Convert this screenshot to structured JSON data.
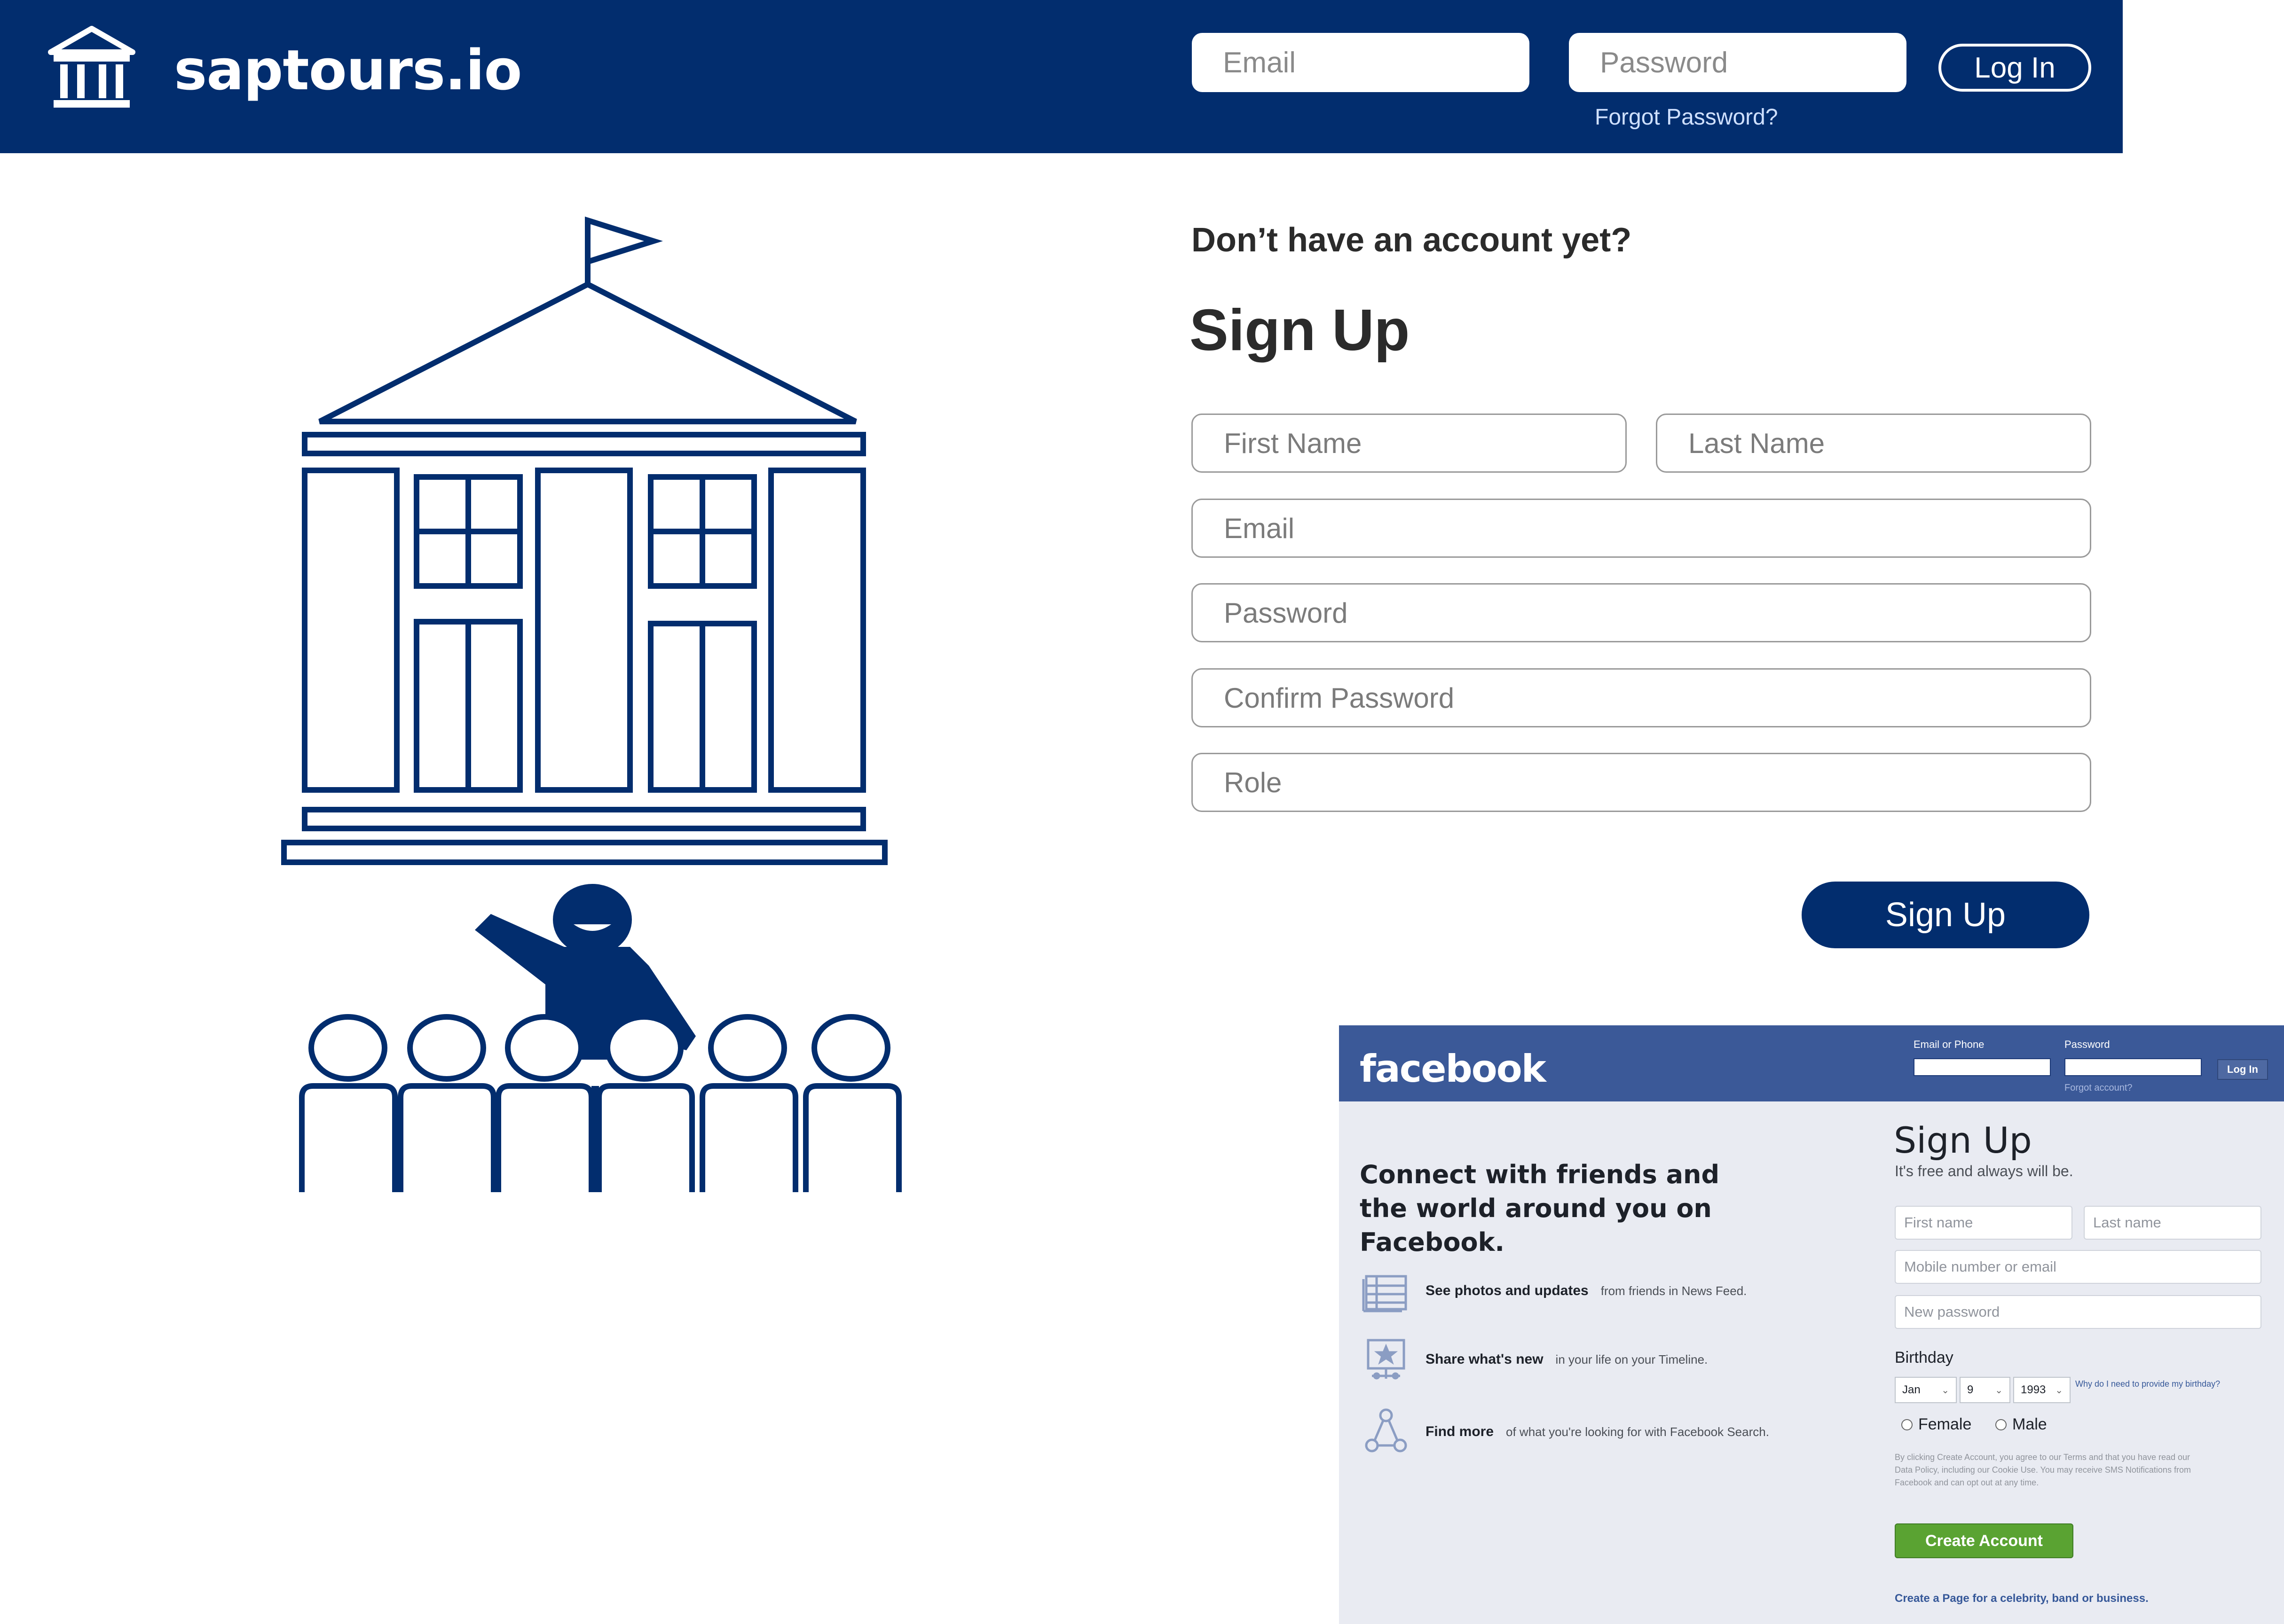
{
  "header": {
    "brand": "saptours.io",
    "email_placeholder": "Email",
    "password_placeholder": "Password",
    "login_label": "Log In",
    "forgot_label": "Forgot Password?"
  },
  "signup": {
    "question": "Don’t have an account yet?",
    "title": "Sign Up",
    "fields": {
      "first_name": "First Name",
      "last_name": "Last Name",
      "email": "Email",
      "password": "Password",
      "confirm_password": "Confirm Password",
      "role": "Role"
    },
    "submit_label": "Sign Up"
  },
  "facebook": {
    "logo": "facebook",
    "email_label": "Email or Phone",
    "password_label": "Password",
    "login_label": "Log In",
    "forgot_label": "Forgot account?",
    "tagline": "Connect with friends and the world around you on Facebook.",
    "features": [
      {
        "bold": "See photos and updates",
        "normal": "from friends in News Feed.",
        "icon": "news-feed-icon"
      },
      {
        "bold": "Share what's new",
        "normal": "in your life on your Timeline.",
        "icon": "timeline-icon"
      },
      {
        "bold": "Find more",
        "normal": "of what you're looking for with Facebook Search.",
        "icon": "search-graph-icon"
      }
    ],
    "signup_title": "Sign Up",
    "signup_sub": "It's free and always will be.",
    "first_name": "First name",
    "last_name": "Last name",
    "mobile": "Mobile number or email",
    "new_password": "New password",
    "birthday_label": "Birthday",
    "birthday_month": "Jan",
    "birthday_day": "9",
    "birthday_year": "1993",
    "why_birthday": "Why do I need to provide my birthday?",
    "female": "Female",
    "male": "Male",
    "terms": "By clicking Create Account, you agree to our Terms and that you have read our Data Policy, including our Cookie Use. You may receive SMS Notifications from Facebook and can opt out at any time.",
    "create_label": "Create Account",
    "create_page": "Create a Page for a celebrity, band or business."
  },
  "colors": {
    "brand_navy": "#022d6e",
    "facebook_blue": "#3b5998",
    "facebook_green": "#5aa332"
  }
}
